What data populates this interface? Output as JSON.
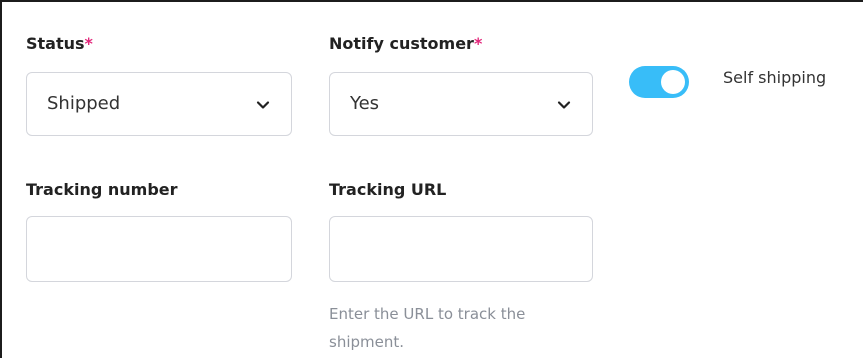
{
  "status": {
    "label": "Status",
    "required_mark": "*",
    "value": "Shipped"
  },
  "notify_customer": {
    "label": "Notify customer",
    "required_mark": "*",
    "value": "Yes"
  },
  "self_shipping": {
    "label": "Self shipping",
    "enabled": true
  },
  "tracking_number": {
    "label": "Tracking number",
    "value": "",
    "placeholder": ""
  },
  "tracking_url": {
    "label": "Tracking URL",
    "value": "",
    "placeholder": "",
    "help": "Enter the URL to track the shipment."
  },
  "colors": {
    "accent": "#38bdf8",
    "required": "#e2267a",
    "border": "#d4d6dc"
  },
  "icons": {
    "dropdown": "chevron-down-icon"
  }
}
